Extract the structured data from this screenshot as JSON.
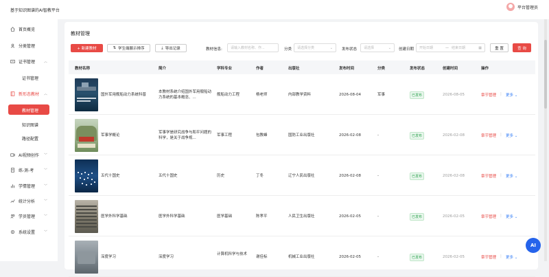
{
  "app": {
    "title": "基于知识图谱的AI智教平台",
    "user": "平台管理员"
  },
  "sidebar": {
    "items": [
      {
        "label": "首页概览",
        "icon": "home-icon"
      },
      {
        "label": "分类管理",
        "icon": "user-icon"
      },
      {
        "label": "证书管理",
        "icon": "certificate-icon",
        "expanded": true
      },
      {
        "label": "证书管理"
      },
      {
        "label": "新形态教材",
        "icon": "book-icon",
        "expanded": true
      },
      {
        "label": "教材管理",
        "active": true
      },
      {
        "label": "知识图谱"
      },
      {
        "label": "路径配置"
      },
      {
        "label": "AI视频创作",
        "icon": "video-icon"
      },
      {
        "label": "练-测-考",
        "icon": "exam-icon"
      },
      {
        "label": "学情管理",
        "icon": "chart-icon"
      },
      {
        "label": "统计分析",
        "icon": "stats-icon"
      },
      {
        "label": "学员管理",
        "icon": "students-icon"
      },
      {
        "label": "系统设置",
        "icon": "settings-icon"
      }
    ]
  },
  "page": {
    "title": "教材管理",
    "toolbar": {
      "new": "+ 新建教材",
      "sort": "学生端展示排序",
      "export": "导出记录"
    },
    "filters": {
      "info_label": "教材信息:",
      "info_placeholder": "请输入教材名称、作...",
      "category_label": "分类",
      "category_placeholder": "请选择分类",
      "status_label": "发布状态",
      "status_placeholder": "请选择",
      "date_label": "创建日期",
      "date_start": "开始日期",
      "date_sep": "—",
      "date_end": "结束日期",
      "reset": "重 置",
      "search": "查 询"
    }
  },
  "table": {
    "columns": [
      "教材名称",
      "简介",
      "学科专业",
      "作者",
      "出版社",
      "发布时间",
      "分类",
      "发布状态",
      "创建时间",
      "操作"
    ],
    "rows": [
      {
        "name": "国外军用舰船动力系统科普",
        "intro": "本教材系统介绍国外军用舰船动力系统的基本概念、...",
        "major": "舰船动力工程",
        "author": "杨老师",
        "publisher": "内部教学资料",
        "publish_time": "2026-08-04",
        "category": "军事",
        "status": "已发布",
        "created": "2026-08-05",
        "op1": "章节管理",
        "op2": "更多"
      },
      {
        "name": "军事学概论",
        "intro": "军事学是研究战争与和平问题的科学，是关于战争规...",
        "major": "军事工程",
        "author": "包教峰",
        "publisher": "国防工业出版社",
        "publish_time": "2026-02-08",
        "category": "-",
        "status": "已发布",
        "created": "2026-02-08",
        "op1": "章节管理",
        "op2": "更多"
      },
      {
        "name": "五代十国史",
        "intro": "五代十国史",
        "major": "历史",
        "author": "丁冬",
        "publisher": "辽宁人民出版社",
        "publish_time": "2026-02-08",
        "category": "-",
        "status": "已发布",
        "created": "2026-02-08",
        "op1": "章节管理",
        "op2": "更多"
      },
      {
        "name": "医学外科学基础",
        "intro": "医学外科学基础",
        "major": "医学基础",
        "author": "陈孝平",
        "publisher": "人民卫生出版社",
        "publish_time": "2026-02-05",
        "category": "-",
        "status": "已发布",
        "created": "2026-02-05",
        "op1": "章节管理",
        "op2": "更多"
      },
      {
        "name": "深度学习",
        "intro": "深度学习",
        "major": "计算机科学与技术",
        "author": "谢佳标",
        "publisher": "机械工业出版社",
        "publish_time": "2026-02-05",
        "category": "-",
        "status": "已发布",
        "created": "2026-02-05",
        "op1": "章节管理",
        "op2": "更多"
      }
    ]
  },
  "float": {
    "ai": "AI"
  },
  "colors": {
    "accent": "#e84a45",
    "link": "#3b82f6",
    "success": "#2ea44f",
    "ai": "#2563eb"
  }
}
